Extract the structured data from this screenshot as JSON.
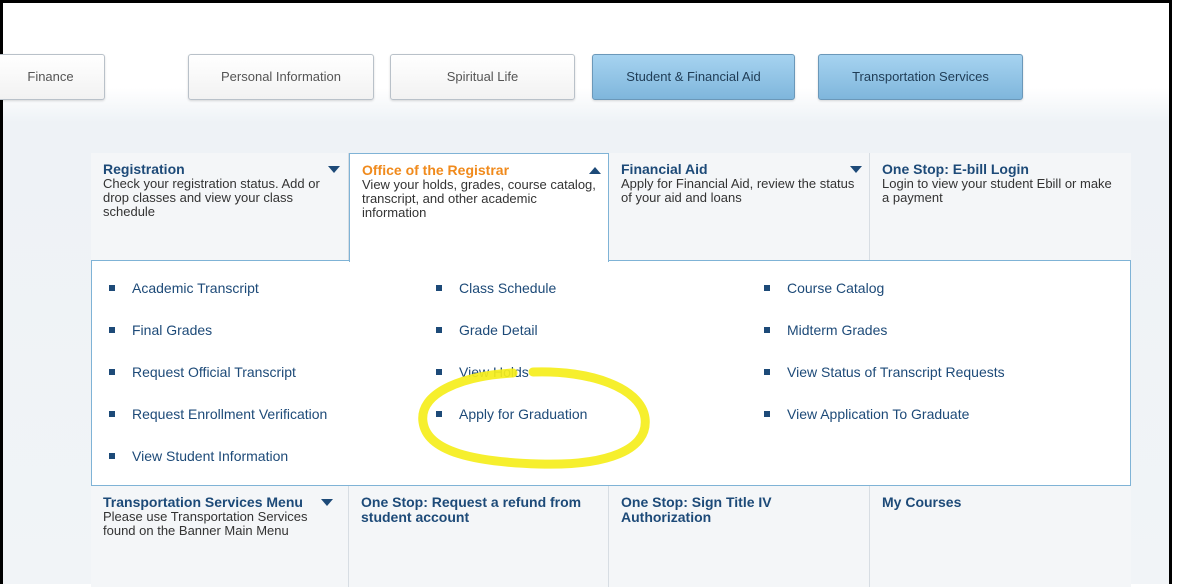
{
  "tabs": [
    {
      "label": "Finance"
    },
    {
      "label": "Personal Information"
    },
    {
      "label": "Spiritual Life"
    },
    {
      "label": "Student & Financial Aid"
    },
    {
      "label": "Transportation Services"
    }
  ],
  "menu_top": [
    {
      "title": "Registration",
      "desc": "Check your registration status. Add or drop classes and view your class schedule"
    },
    {
      "title": "Office of the Registrar",
      "desc": "View your holds, grades, course catalog, transcript, and other academic information"
    },
    {
      "title": "Financial Aid",
      "desc": "Apply for Financial Aid, review the status of your aid and loans"
    },
    {
      "title": "One Stop: E-bill Login",
      "desc": "Login to view your student Ebill or make a payment"
    }
  ],
  "registrar_links": [
    "Academic Transcript",
    "Class Schedule",
    "Course Catalog",
    "Final Grades",
    "Grade Detail",
    "Midterm Grades",
    "Request Official Transcript",
    "View Holds",
    "View Status of Transcript Requests",
    "Request Enrollment Verification",
    "Apply for Graduation",
    "View Application To Graduate",
    "View Student Information"
  ],
  "menu_bottom": [
    {
      "title": "Transportation Services Menu",
      "desc": "Please use Transportation Services found on the Banner Main Menu"
    },
    {
      "title": "One Stop: Request a refund from student account",
      "desc": ""
    },
    {
      "title": "One Stop: Sign Title IV Authorization",
      "desc": ""
    },
    {
      "title": "My Courses",
      "desc": ""
    }
  ],
  "colors": {
    "link": "#1d4a78",
    "active_title": "#f08a1c",
    "highlight": "#f5ee1b",
    "active_tab": "#8fc3e6"
  }
}
